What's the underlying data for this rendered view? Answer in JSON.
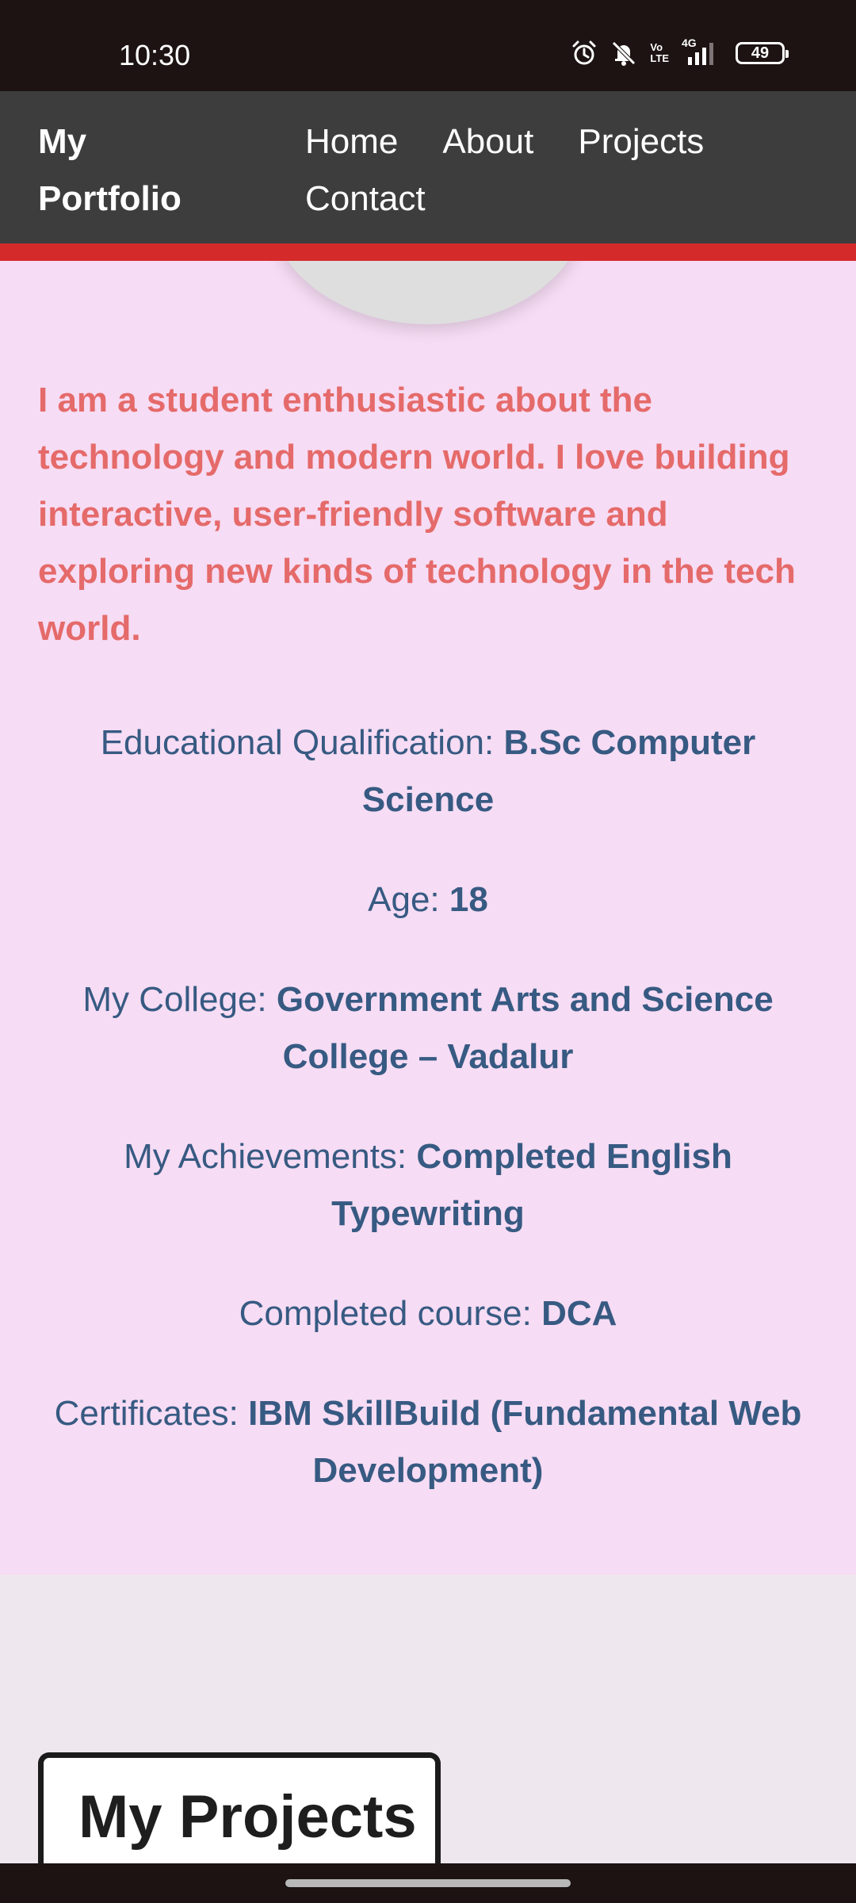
{
  "status_bar": {
    "time": "10:30",
    "network": "4G",
    "volte_top": "Vo",
    "volte_bottom": "LTE",
    "battery": "49",
    "icons": [
      "alarm-icon",
      "mute-icon",
      "volte-icon",
      "signal-icon",
      "battery-icon"
    ]
  },
  "navbar": {
    "brand_line1": "My",
    "brand_line2": "Portfolio",
    "links": [
      "Home",
      "About",
      "Projects",
      "Contact"
    ]
  },
  "about": {
    "intro": "I am a student enthusiastic about the technology and modern world. I love building interactive, user-friendly software and exploring new kinds of technology in the tech world.",
    "items": [
      {
        "label": "Educational Qualification: ",
        "value": "B.Sc Computer Science"
      },
      {
        "label": "Age: ",
        "value": "18"
      },
      {
        "label": "My College: ",
        "value": "Government Arts and Science College – Vadalur"
      },
      {
        "label": "My Achievements: ",
        "value": "Completed English Typewriting"
      },
      {
        "label": "Completed course: ",
        "value": "DCA"
      },
      {
        "label": "Certificates: ",
        "value": "IBM SkillBuild (Fundamental Web Development)"
      }
    ]
  },
  "projects": {
    "heading": "My Projects"
  },
  "colors": {
    "nav_background": "#3d3d3d",
    "nav_accent": "#d42a2a",
    "about_background": "#f6dcf4",
    "intro_text": "#e56a6a",
    "info_text": "#375a82",
    "page_background": "#eee8ee"
  }
}
